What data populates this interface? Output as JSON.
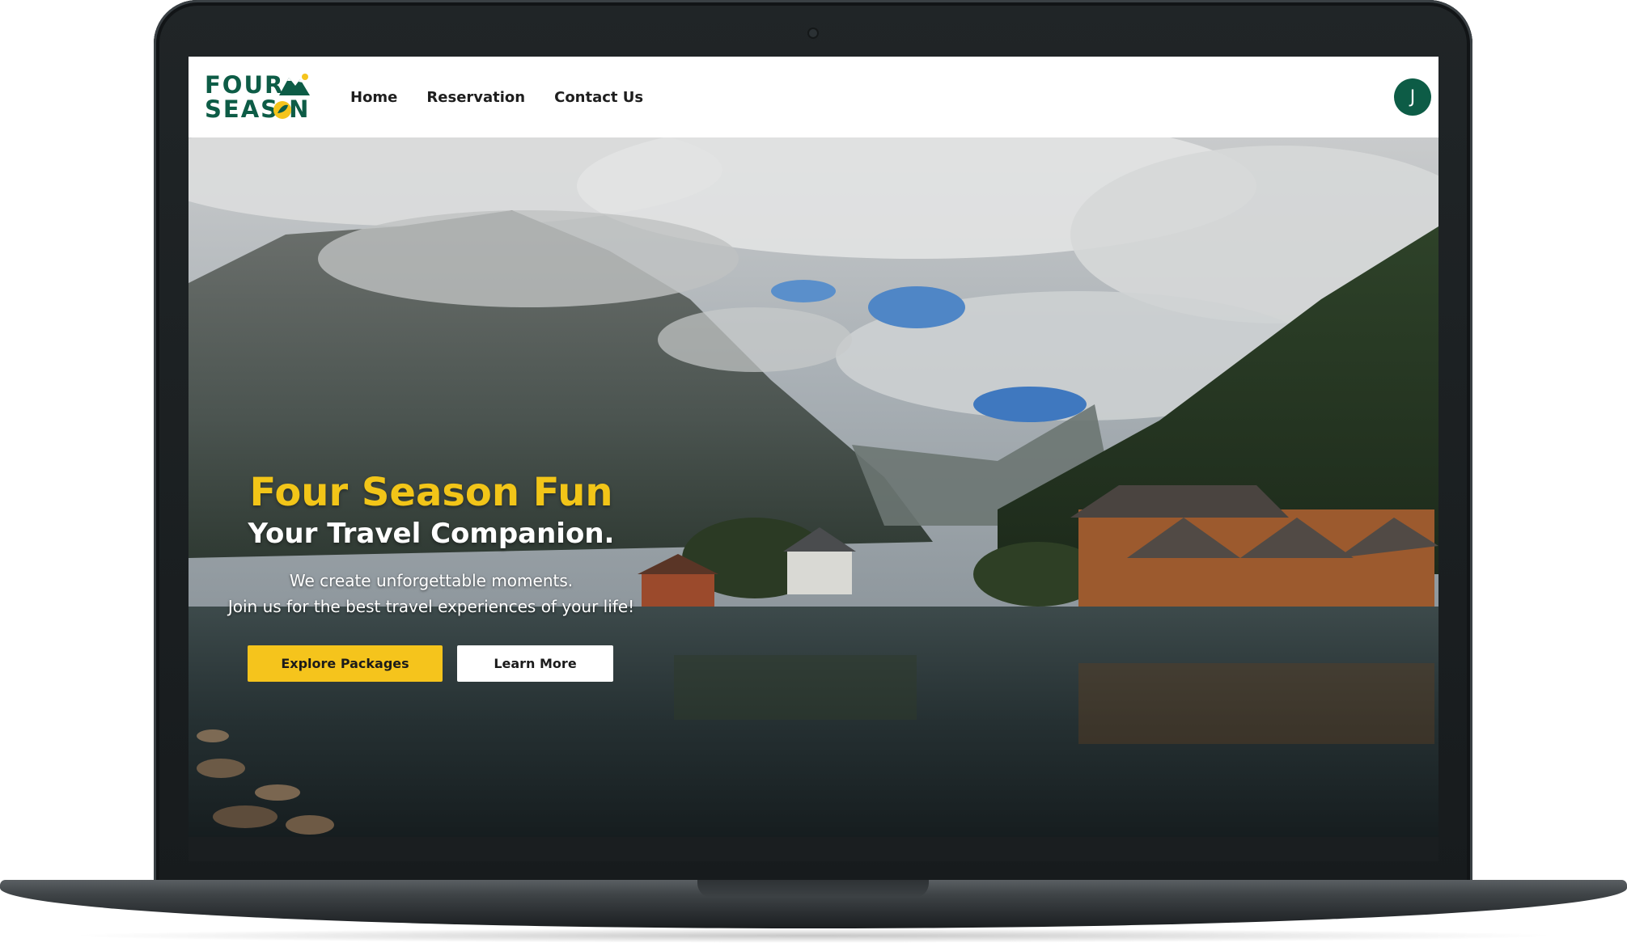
{
  "nav": {
    "logo_line1": "FOUR",
    "logo_line2": "SEAS N",
    "links": [
      "Home",
      "Reservation",
      "Contact Us"
    ],
    "avatar_initial": "J"
  },
  "hero": {
    "title": "Four Season Fun",
    "subtitle": "Your Travel Companion.",
    "description_line1": "We create unforgettable moments.",
    "description_line2": "Join us for the best travel experiences of your life!",
    "primary_button": "Explore Packages",
    "secondary_button": "Learn More"
  },
  "colors": {
    "brand_green": "#0d5c46",
    "accent_yellow": "#f5c41c"
  }
}
